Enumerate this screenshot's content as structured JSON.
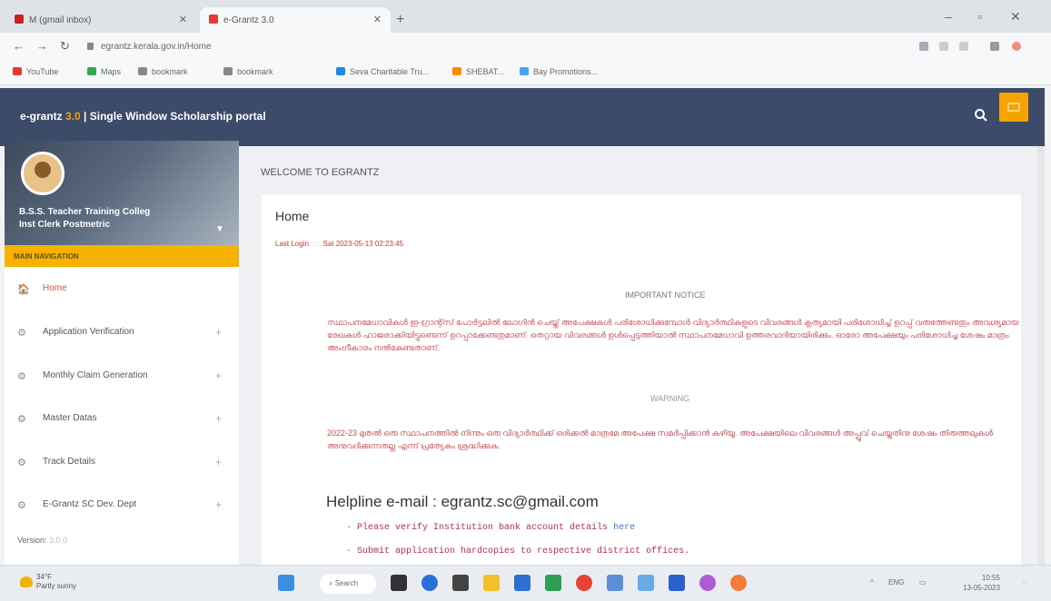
{
  "browser": {
    "tabs": [
      {
        "title": "M  (gmail inbox)",
        "favicon_color": "#c5221f"
      },
      {
        "title": "e-Grantz 3.0",
        "favicon_color": "#e53935"
      }
    ],
    "url": "egrantz.kerala.gov.in/Home",
    "bookmarks": [
      {
        "label": "YouTube",
        "color": "#e53935"
      },
      {
        "label": "Maps",
        "color": "#34a853"
      },
      {
        "label": "bookmark",
        "color": "#888888"
      },
      {
        "label": "bookmark",
        "color": "#888888"
      },
      {
        "label": "Seva Charitable Tru...",
        "color": "#1e88e5"
      },
      {
        "label": "SHEBAT...",
        "color": "#fb8c00"
      },
      {
        "label": "Bay Promotions...",
        "color": "#42a5f5"
      }
    ]
  },
  "header": {
    "brand": "e-grantz",
    "version": "3.0",
    "separator": "|",
    "title": "Single Window Scholarship portal"
  },
  "sidebar": {
    "user_name": "B.S.S. Teacher Training Colleg",
    "user_role": "Inst Clerk Postmetric",
    "main_nav": "MAIN NAVIGATION",
    "items": [
      {
        "label": "Home",
        "icon": "home-icon",
        "glyph": "🏠"
      },
      {
        "label": "Application Verification",
        "icon": "gear-icon",
        "glyph": "⚙",
        "plus": "+"
      },
      {
        "label": "Monthly Claim Generation",
        "icon": "gear-icon",
        "glyph": "⚙",
        "plus": "+"
      },
      {
        "label": "Master Datas",
        "icon": "gear-icon",
        "glyph": "⚙",
        "plus": "+"
      },
      {
        "label": "Track Details",
        "icon": "gear-icon",
        "glyph": "⚙",
        "plus": "+"
      },
      {
        "label": "E-Grantz SC Dev. Dept",
        "icon": "gear-icon",
        "glyph": "⚙",
        "plus": "+"
      }
    ],
    "version_label": "Version:",
    "version_value": "3.0.0"
  },
  "main": {
    "welcome": "WELCOME TO EGRANTZ",
    "title": "Home",
    "last_login_label": "Last Login",
    "last_login_value": "Sat 2023-05-13 02:23:45",
    "notice_heading": "IMPORTANT NOTICE",
    "notice_text": "സ്ഥാപനമേധാവികൾ ഇ-ഗ്രാന്റ്സ് പോർട്ടലിൽ ലോഗിൻ ചെയ്ത് അപേക്ഷകൾ പരിശോധിക്കുമ്പോൾ വിദ്യാർത്ഥികളുടെ വിവരങ്ങൾ കൃത്യമായി പരിശോധിച്ച് ഉറപ്പ് വരുത്തേണ്ടതും അവശ്യമായ രേഖകൾ ഹാജരാക്കിയിട്ടുണ്ടെന്ന് ഉറപ്പാക്കേണ്ടതുമാണ്. തെറ്റായ വിവരങ്ങൾ ഉൾപ്പെടുത്തിയാൽ സ്ഥാപനമേധാവി ഉത്തരവാദിയായിരിക്കും. ഓരോ അപേക്ഷയും പരിശോധിച്ച ശേഷം മാത്രം അംഗീകാരം നൽകേണ്ടതാണ്.",
    "warning_heading": "WARNING",
    "warning_text": "2022-23 മുതൽ ഒരു സ്ഥാപനത്തിൽ നിന്നും ഒരു വിദ്യാർത്ഥിക്ക് ഒരിക്കൽ മാത്രമേ അപേക്ഷ സമർപ്പിക്കാൻ കഴിയൂ. അപേക്ഷയിലെ വിവരങ്ങൾ അപ്പ്രൂവ് ചെയ്തതിനു ശേഷം തിരുത്തലുകൾ അനുവദിക്കുന്നതല്ല എന്ന് പ്രത്യേകം ശ്രദ്ധിക്കുക.",
    "helpline": "Helpline e-mail : egrantz.sc@gmail.com",
    "bullets": [
      {
        "text": "Please verify Institution bank account details ",
        "link": "here"
      },
      {
        "text": "Submit application hardcopies to respective district offices.",
        "link": ""
      }
    ]
  },
  "taskbar": {
    "weather_temp": "34°F",
    "weather_desc": "Partly sunny",
    "search_label": "Search",
    "tray_lang": "ENG",
    "time": "10:55",
    "date": "13-05-2023"
  }
}
